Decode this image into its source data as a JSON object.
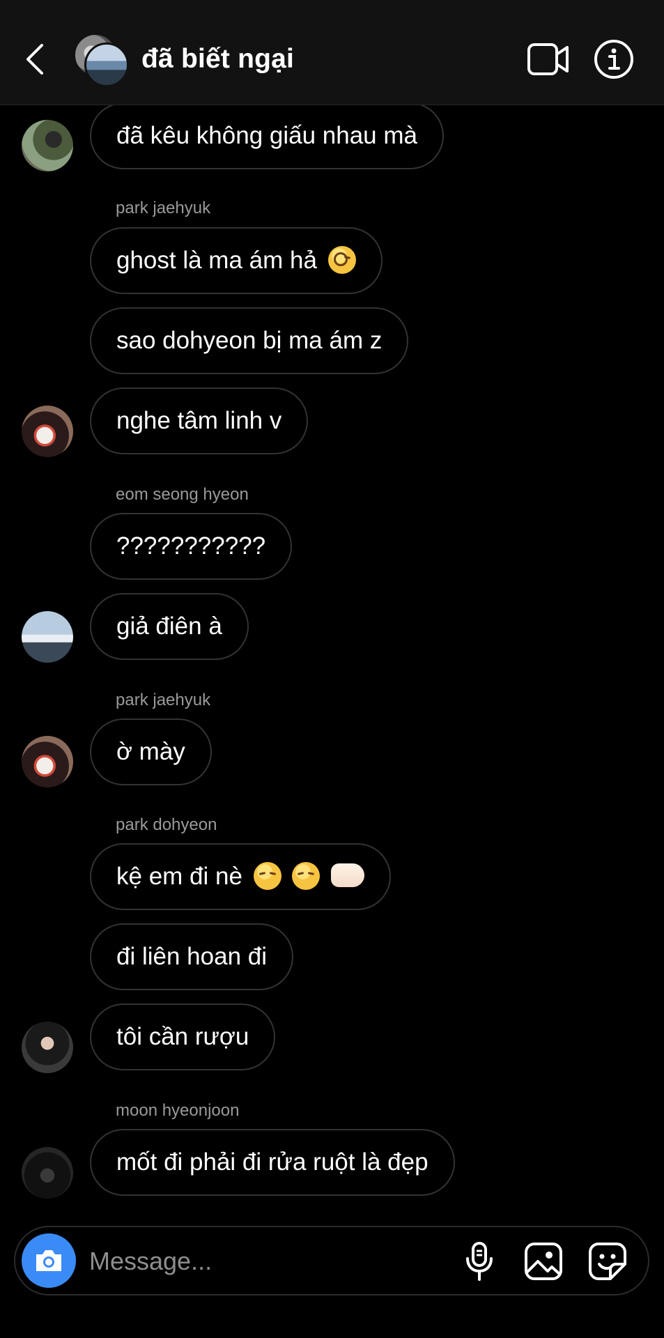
{
  "header": {
    "title": "đã biết ngại",
    "back_icon": "chevron-left-icon",
    "video_icon": "video-camera-icon",
    "info_icon": "info-icon"
  },
  "messages": [
    {
      "text": "đã kêu không giấu nhau mà"
    },
    {
      "sender": "park jaehyuk",
      "text": "ghost là ma ám hả",
      "emoji": "face-with-monocle"
    },
    {
      "text": "sao dohyeon bị ma ám z"
    },
    {
      "text": "nghe tâm linh v"
    },
    {
      "sender": "eom seong hyeon",
      "text": "???????????"
    },
    {
      "text": "giả điên à"
    },
    {
      "sender": "park jaehyuk",
      "text": "ờ mày"
    },
    {
      "sender": "park dohyeon",
      "text": "kệ em đi nè",
      "emoji": "disappointed-face disappointed-face left-facing-fist"
    },
    {
      "text": "đi liên hoan đi"
    },
    {
      "text": "tôi cần rượu"
    },
    {
      "sender": "moon hyeonjoon",
      "text": "mốt đi phải đi rửa ruột là đẹp"
    }
  ],
  "composer": {
    "placeholder": "Message...",
    "camera_icon": "camera-icon",
    "mic_icon": "microphone-icon",
    "gallery_icon": "image-icon",
    "sticker_icon": "sticker-icon",
    "accent_color": "#3a8bf6"
  }
}
